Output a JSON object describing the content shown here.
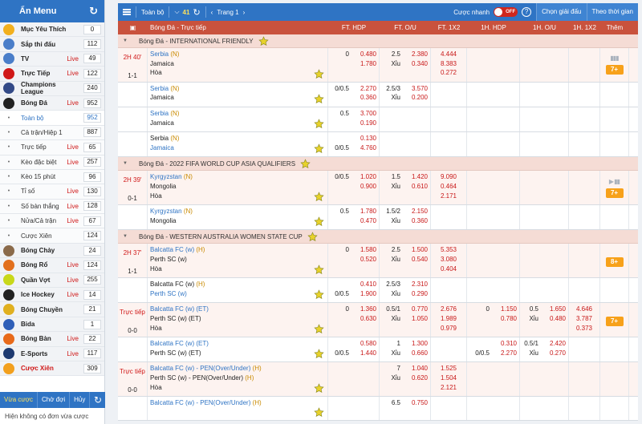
{
  "sidebar": {
    "title": "Ẩn Menu",
    "refresh_icon": "refresh-icon",
    "items": [
      {
        "label": "Mục Yêu Thích",
        "live": "",
        "count": "0",
        "icon": "star-icon",
        "color": "#f2b01e",
        "kind": "section"
      },
      {
        "label": "Sắp thi đấu",
        "live": "",
        "count": "112",
        "icon": "calendar-icon",
        "color": "#4a7ec9",
        "kind": "section"
      },
      {
        "label": "TV",
        "live": "Live",
        "count": "49",
        "icon": "tv-icon",
        "color": "#4a7ec9",
        "kind": "section"
      },
      {
        "label": "Trực Tiếp",
        "live": "Live",
        "count": "122",
        "icon": "runner-icon",
        "color": "#d01818",
        "kind": "section"
      },
      {
        "label": "Champions League",
        "live": "",
        "count": "240",
        "icon": "trophy-icon",
        "color": "#334a87",
        "kind": "section"
      },
      {
        "label": "Bóng Đá",
        "live": "Live",
        "count": "952",
        "icon": "soccer-ball-icon",
        "color": "#222222",
        "kind": "section"
      },
      {
        "label": "Toàn bộ",
        "live": "",
        "count": "952",
        "kind": "sub",
        "active": true
      },
      {
        "label": "Cả trận/Hiệp 1",
        "live": "",
        "count": "887",
        "kind": "sub"
      },
      {
        "label": "Trực tiếp",
        "live": "Live",
        "count": "65",
        "kind": "sub"
      },
      {
        "label": "Kèo đặc biệt",
        "live": "Live",
        "count": "257",
        "kind": "sub"
      },
      {
        "label": "Kèo 15 phút",
        "live": "",
        "count": "96",
        "kind": "sub"
      },
      {
        "label": "Tỉ số",
        "live": "Live",
        "count": "130",
        "kind": "sub"
      },
      {
        "label": "Số bàn thắng",
        "live": "Live",
        "count": "128",
        "kind": "sub"
      },
      {
        "label": "Nửa/Cả trận",
        "live": "Live",
        "count": "67",
        "kind": "sub"
      },
      {
        "label": "Cược Xiên",
        "live": "",
        "count": "124",
        "kind": "sub"
      },
      {
        "label": "Bóng Chày",
        "live": "",
        "count": "24",
        "icon": "baseball-icon",
        "color": "#8a6a4a",
        "kind": "section"
      },
      {
        "label": "Bóng Rổ",
        "live": "Live",
        "count": "124",
        "icon": "basketball-icon",
        "color": "#e2701e",
        "kind": "section"
      },
      {
        "label": "Quần Vợt",
        "live": "Live",
        "count": "255",
        "icon": "tennis-ball-icon",
        "color": "#c8d81a",
        "kind": "section"
      },
      {
        "label": "Ice Hockey",
        "live": "Live",
        "count": "14",
        "icon": "hockey-icon",
        "color": "#222222",
        "kind": "section"
      },
      {
        "label": "Bóng Chuyền",
        "live": "",
        "count": "21",
        "icon": "volleyball-icon",
        "color": "#e0b020",
        "kind": "section"
      },
      {
        "label": "Bida",
        "live": "",
        "count": "1",
        "icon": "billiards-icon",
        "color": "#2f5fb8",
        "kind": "section"
      },
      {
        "label": "Bóng Bàn",
        "live": "Live",
        "count": "22",
        "icon": "table-tennis-icon",
        "color": "#e86a1a",
        "kind": "section"
      },
      {
        "label": "E-Sports",
        "live": "Live",
        "count": "117",
        "icon": "esports-icon",
        "color": "#1e3a70",
        "kind": "section"
      },
      {
        "label": "Cược Xiên",
        "live": "",
        "count": "309",
        "icon": "parlay-icon",
        "color": "#f2a01e",
        "kind": "section",
        "red": true
      }
    ],
    "tabs": [
      "Vừa cược",
      "Chờ đợi",
      "Hủy"
    ],
    "empty_text": "Hiện không có đơn vừa cược"
  },
  "toolbar": {
    "filter_label": "Toàn bộ",
    "count": "41",
    "page_label": "Trang 1",
    "quick_bet_label": "Cược nhanh",
    "toggle_label": "OFF",
    "help": "?",
    "select_league_label": "Chọn giải đấu",
    "sort_label": "Theo thời gian"
  },
  "table": {
    "headers": [
      "Bóng Đá - Trực tiếp",
      "FT. HDP",
      "FT. O/U",
      "FT. 1X2",
      "1H. HDP",
      "1H. O/U",
      "1H. 1X2",
      "Thêm"
    ],
    "leagues": [
      {
        "name": "Bóng Đá - INTERNATIONAL FRIENDLY",
        "matches": [
          {
            "time": "2H 40'",
            "score": "1-1",
            "home": "Serbia",
            "home_tag": "(N)",
            "away": "Jamaica",
            "away_tag": "",
            "draw": "Hòa",
            "hdp": [
              [
                "0",
                "0.480"
              ],
              [
                "",
                "1.780"
              ]
            ],
            "ou": [
              [
                "2.5",
                "2.380"
              ],
              [
                "Xỉu",
                "0.340"
              ]
            ],
            "x12": [
              "4.444",
              "8.383",
              "0.272"
            ],
            "h1hdp": [],
            "h1ou": [],
            "h1x12": [],
            "more": "7+",
            "stats": "▮▮▮"
          },
          {
            "time": "",
            "score": "",
            "home": "Serbia",
            "home_tag": "(N)",
            "away": "Jamaica",
            "away_tag": "",
            "draw": "",
            "hdp": [
              [
                "0/0.5",
                "2.270"
              ],
              [
                "",
                "0.360"
              ]
            ],
            "ou": [
              [
                "2.5/3",
                "3.570"
              ],
              [
                "Xỉu",
                "0.200"
              ]
            ],
            "x12": [],
            "h1hdp": [],
            "h1ou": [],
            "h1x12": [],
            "more": "",
            "stats": ""
          },
          {
            "time": "",
            "score": "",
            "home": "Serbia",
            "home_tag": "(N)",
            "away": "Jamaica",
            "away_tag": "",
            "draw": "",
            "hdp": [
              [
                "0.5",
                "3.700"
              ],
              [
                "",
                "0.190"
              ]
            ],
            "ou": [],
            "x12": [],
            "h1hdp": [],
            "h1ou": [],
            "h1x12": [],
            "more": "",
            "stats": ""
          },
          {
            "time": "",
            "score": "",
            "home": "Serbia",
            "home_tag": "(N)",
            "away": "Jamaica",
            "away_tag": "",
            "draw": "",
            "hdp": [
              [
                "",
                "0.130"
              ],
              [
                "0/0.5",
                "4.760"
              ]
            ],
            "ou": [],
            "x12": [],
            "h1hdp": [],
            "h1ou": [],
            "h1x12": [],
            "more": "",
            "stats": "",
            "away_fav": true
          }
        ]
      },
      {
        "name": "Bóng Đá - 2022 FIFA WORLD CUP ASIA QUALIFIERS",
        "matches": [
          {
            "time": "2H 39'",
            "score": "0-1",
            "home": "Kyrgyzstan",
            "home_tag": "(N)",
            "away": "Mongolia",
            "away_tag": "",
            "draw": "Hòa",
            "hdp": [
              [
                "0/0.5",
                "1.020"
              ],
              [
                "",
                "0.900"
              ]
            ],
            "ou": [
              [
                "1.5",
                "1.420"
              ],
              [
                "Xỉu",
                "0.610"
              ]
            ],
            "x12": [
              "9.090",
              "0.464",
              "2.171"
            ],
            "h1hdp": [],
            "h1ou": [],
            "h1x12": [],
            "more": "7+",
            "stats": "▶ ▮▮"
          },
          {
            "time": "",
            "score": "",
            "home": "Kyrgyzstan",
            "home_tag": "(N)",
            "away": "Mongolia",
            "away_tag": "",
            "draw": "",
            "hdp": [
              [
                "0.5",
                "1.780"
              ],
              [
                "",
                "0.470"
              ]
            ],
            "ou": [
              [
                "1.5/2",
                "2.150"
              ],
              [
                "Xỉu",
                "0.360"
              ]
            ],
            "x12": [],
            "h1hdp": [],
            "h1ou": [],
            "h1x12": [],
            "more": "",
            "stats": ""
          }
        ]
      },
      {
        "name": "Bóng Đá - WESTERN AUSTRALIA WOMEN STATE CUP",
        "matches": [
          {
            "time": "2H 37'",
            "score": "1-1",
            "home": "Balcatta FC (w)",
            "home_tag": "(H)",
            "away": "Perth SC (w)",
            "away_tag": "",
            "draw": "Hòa",
            "hdp": [
              [
                "0",
                "1.580"
              ],
              [
                "",
                "0.520"
              ]
            ],
            "ou": [
              [
                "2.5",
                "1.500"
              ],
              [
                "Xỉu",
                "0.540"
              ]
            ],
            "x12": [
              "5.353",
              "3.080",
              "0.404"
            ],
            "h1hdp": [],
            "h1ou": [],
            "h1x12": [],
            "more": "8+",
            "stats": ""
          },
          {
            "time": "",
            "score": "",
            "home": "Balcatta FC (w)",
            "home_tag": "(H)",
            "away": "Perth SC (w)",
            "away_tag": "",
            "draw": "",
            "hdp": [
              [
                "",
                "0.410"
              ],
              [
                "0/0.5",
                "1.900"
              ]
            ],
            "ou": [
              [
                "2.5/3",
                "2.310"
              ],
              [
                "Xỉu",
                "0.290"
              ]
            ],
            "x12": [],
            "h1hdp": [],
            "h1ou": [],
            "h1x12": [],
            "more": "",
            "stats": "",
            "away_fav": true
          },
          {
            "time": "Trực tiếp",
            "score": "0-0",
            "home": "Balcatta FC (w) (ET)",
            "home_tag": "",
            "away": "Perth SC (w) (ET)",
            "away_tag": "",
            "draw": "Hòa",
            "hdp": [
              [
                "0",
                "1.360"
              ],
              [
                "",
                "0.630"
              ]
            ],
            "ou": [
              [
                "0.5/1",
                "0.770"
              ],
              [
                "Xỉu",
                "1.050"
              ]
            ],
            "x12": [
              "2.676",
              "1.989",
              "0.979"
            ],
            "h1hdp": [
              [
                "0",
                "1.150"
              ],
              [
                "",
                "0.780"
              ]
            ],
            "h1ou": [
              [
                "0.5",
                "1.650"
              ],
              [
                "Xỉu",
                "0.480"
              ]
            ],
            "h1x12": [
              "4.646",
              "3.787",
              "0.373"
            ],
            "more": "7+",
            "stats": ""
          },
          {
            "time": "",
            "score": "",
            "home": "Balcatta FC (w) (ET)",
            "home_tag": "",
            "away": "Perth SC (w) (ET)",
            "away_tag": "",
            "draw": "",
            "hdp": [
              [
                "",
                "0.580"
              ],
              [
                "0/0.5",
                "1.440"
              ]
            ],
            "ou": [
              [
                "1",
                "1.300"
              ],
              [
                "Xỉu",
                "0.660"
              ]
            ],
            "x12": [],
            "h1hdp": [
              [
                "",
                "0.310"
              ],
              [
                "0/0.5",
                "2.270"
              ]
            ],
            "h1ou": [
              [
                "0.5/1",
                "2.420"
              ],
              [
                "Xỉu",
                "0.270"
              ]
            ],
            "h1x12": [],
            "more": "",
            "stats": ""
          },
          {
            "time": "Trực tiếp",
            "score": "0-0",
            "home": "Balcatta FC (w) - PEN(Over/Under)",
            "home_tag": "(H)",
            "away": "Perth SC (w) - PEN(Over/Under)",
            "away_tag": "(H)",
            "draw": "Hòa",
            "hdp": [],
            "ou": [
              [
                "7",
                "1.040"
              ],
              [
                "Xỉu",
                "0.620"
              ]
            ],
            "x12": [
              "1.525",
              "1.504",
              "2.121"
            ],
            "h1hdp": [],
            "h1ou": [],
            "h1x12": [],
            "more": "",
            "stats": ""
          },
          {
            "time": "",
            "score": "",
            "home": "Balcatta FC (w) - PEN(Over/Under)",
            "home_tag": "(H)",
            "away": "",
            "away_tag": "",
            "draw": "",
            "hdp": [],
            "ou": [
              [
                "6.5",
                "0.750"
              ]
            ],
            "x12": [],
            "h1hdp": [],
            "h1ou": [],
            "h1x12": [],
            "more": "",
            "stats": ""
          }
        ]
      }
    ]
  },
  "colors": {
    "accent": "#2f74c4",
    "header": "#c9523d",
    "league_bg": "#f5dcd5",
    "odds_red": "#c81818",
    "more_btn": "#f7a11a"
  }
}
